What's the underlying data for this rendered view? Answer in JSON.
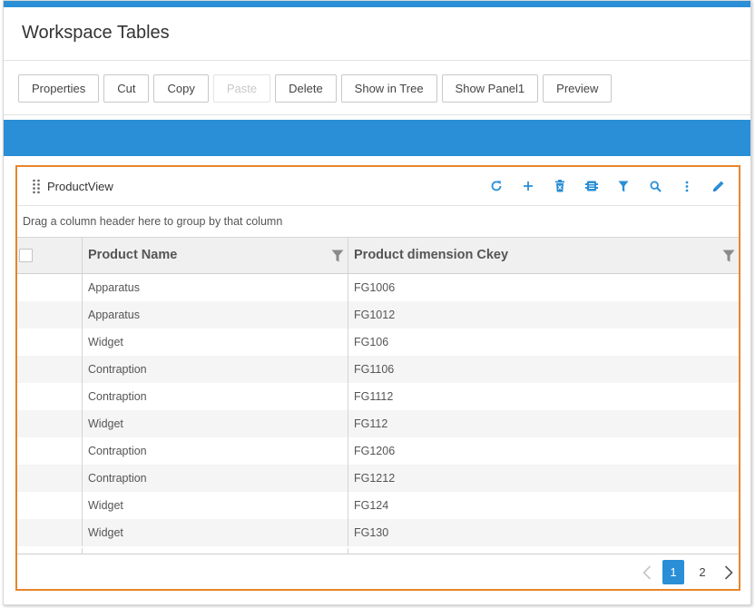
{
  "header": {
    "title": "Workspace Tables"
  },
  "toolbar": {
    "buttons": [
      {
        "label": "Properties",
        "enabled": true
      },
      {
        "label": "Cut",
        "enabled": true
      },
      {
        "label": "Copy",
        "enabled": true
      },
      {
        "label": "Paste",
        "enabled": false
      },
      {
        "label": "Delete",
        "enabled": true
      },
      {
        "label": "Show in Tree",
        "enabled": true
      },
      {
        "label": "Show Panel1",
        "enabled": true
      },
      {
        "label": "Preview",
        "enabled": true
      }
    ]
  },
  "colors": {
    "accent": "#2a8fd6",
    "panel_border": "#e8852a"
  },
  "panel": {
    "title": "ProductView",
    "tools": [
      "refresh-icon",
      "add-icon",
      "delete-icon",
      "export-icon",
      "filter-icon",
      "search-icon",
      "more-icon",
      "edit-icon"
    ],
    "group_hint": "Drag a column header here to group by that column"
  },
  "grid": {
    "columns": [
      "Product Name",
      "Product dimension Ckey"
    ],
    "rows": [
      {
        "name": "Apparatus",
        "key": "FG1006"
      },
      {
        "name": "Apparatus",
        "key": "FG1012"
      },
      {
        "name": "Widget",
        "key": "FG106"
      },
      {
        "name": "Contraption",
        "key": "FG1106"
      },
      {
        "name": "Contraption",
        "key": "FG1112"
      },
      {
        "name": "Widget",
        "key": "FG112"
      },
      {
        "name": "Contraption",
        "key": "FG1206"
      },
      {
        "name": "Contraption",
        "key": "FG1212"
      },
      {
        "name": "Widget",
        "key": "FG124"
      },
      {
        "name": "Widget",
        "key": "FG130"
      }
    ]
  },
  "pager": {
    "current": "1",
    "pages": [
      "1",
      "2"
    ]
  }
}
